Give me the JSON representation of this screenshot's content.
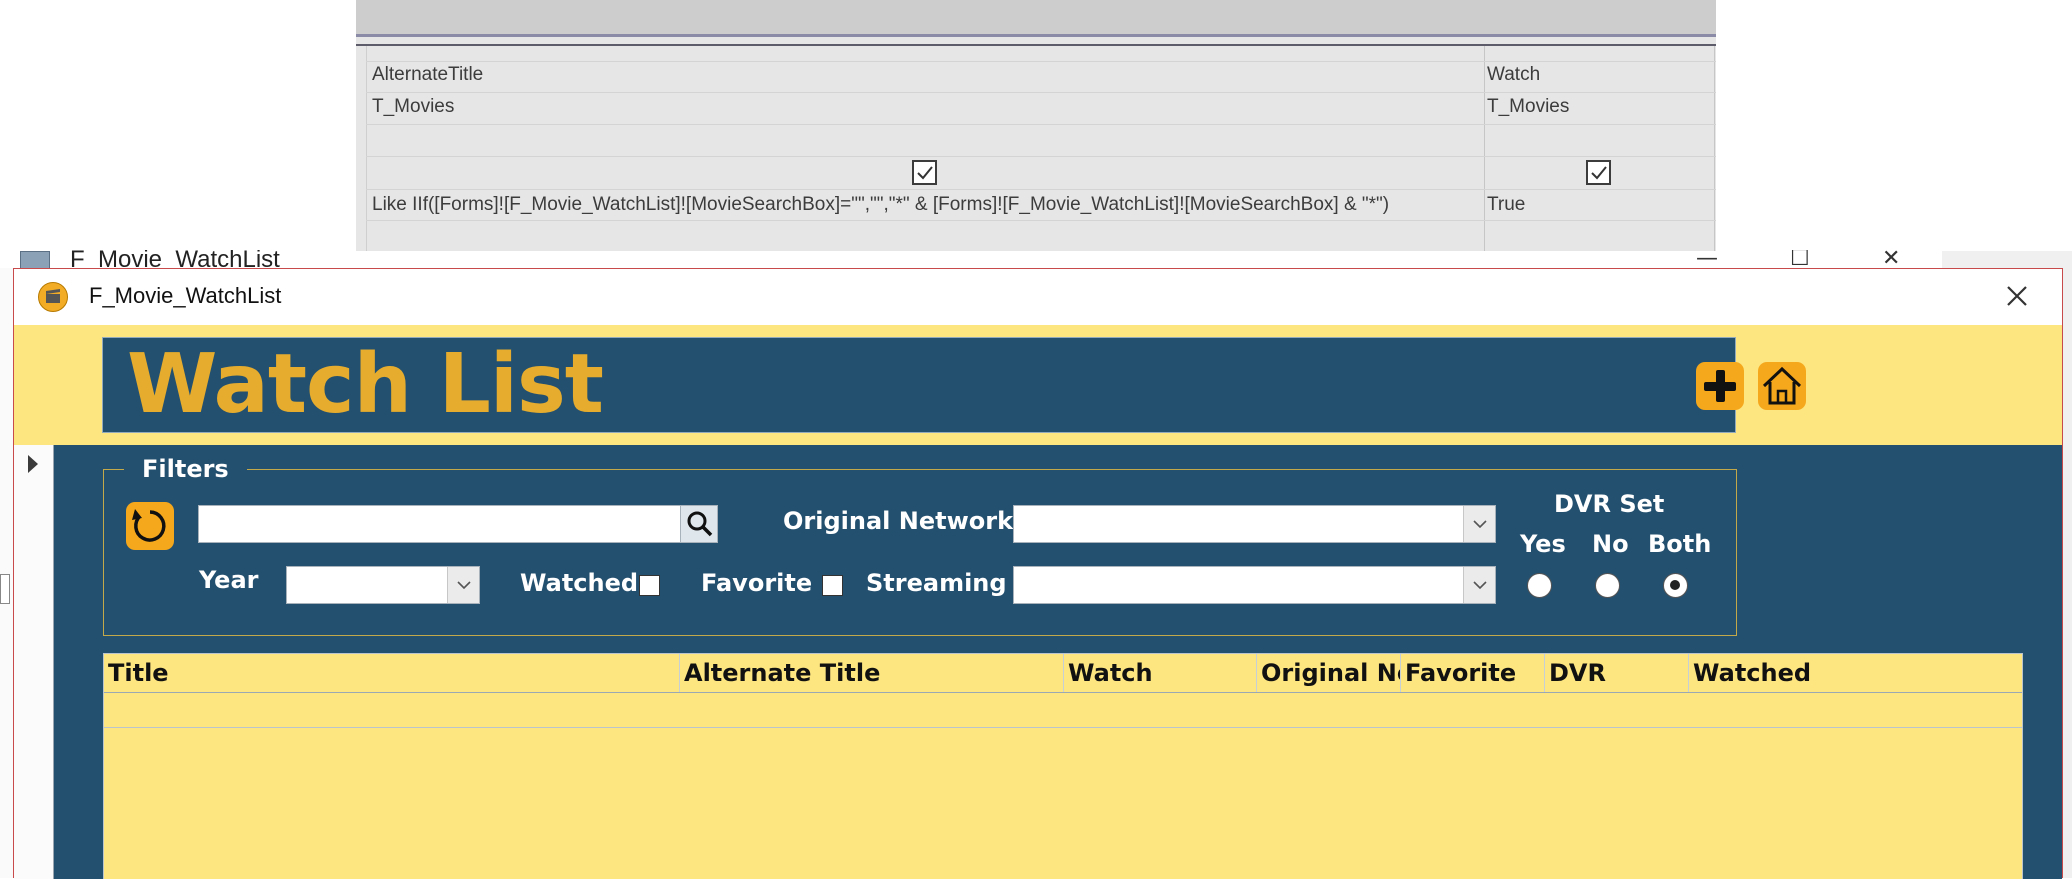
{
  "query_designer": {
    "columns": [
      {
        "field": "AlternateTitle",
        "table": "T_Movies",
        "show": true,
        "criteria": "Like IIf([Forms]![F_Movie_WatchList]![MovieSearchBox]=\"\",\"\",\"*\" & [Forms]![F_Movie_WatchList]![MovieSearchBox] & \"*\")"
      },
      {
        "field": "Watch",
        "table": "T_Movies",
        "show": true,
        "criteria": "True"
      }
    ]
  },
  "background_window": {
    "title": "F_Movie_WatchList"
  },
  "window": {
    "title": "F_Movie_WatchList",
    "close_glyph": "✕"
  },
  "header": {
    "title": "Watch List",
    "add_icon": "plus-icon",
    "home_icon": "home-icon"
  },
  "filters": {
    "legend": "Filters",
    "search": {
      "value": "",
      "placeholder": ""
    },
    "original_network": {
      "label": "Original Network",
      "value": ""
    },
    "year": {
      "label": "Year",
      "value": ""
    },
    "watched": {
      "label": "Watched",
      "checked": false
    },
    "favorite": {
      "label": "Favorite",
      "checked": false
    },
    "streaming": {
      "label": "Streaming",
      "value": ""
    },
    "dvr_set": {
      "label": "DVR Set",
      "options": [
        "Yes",
        "No",
        "Both"
      ],
      "selected": "Both"
    }
  },
  "datasheet": {
    "columns": [
      "Title",
      "Alternate Title",
      "Watch",
      "Original Network",
      "Favorite",
      "DVR",
      "Watched"
    ],
    "rows": []
  },
  "colors": {
    "header_yellow": "#fde580",
    "banner_blue": "#24506f",
    "title_gold": "#e5ac2d",
    "button_orange": "#f5a81c"
  }
}
